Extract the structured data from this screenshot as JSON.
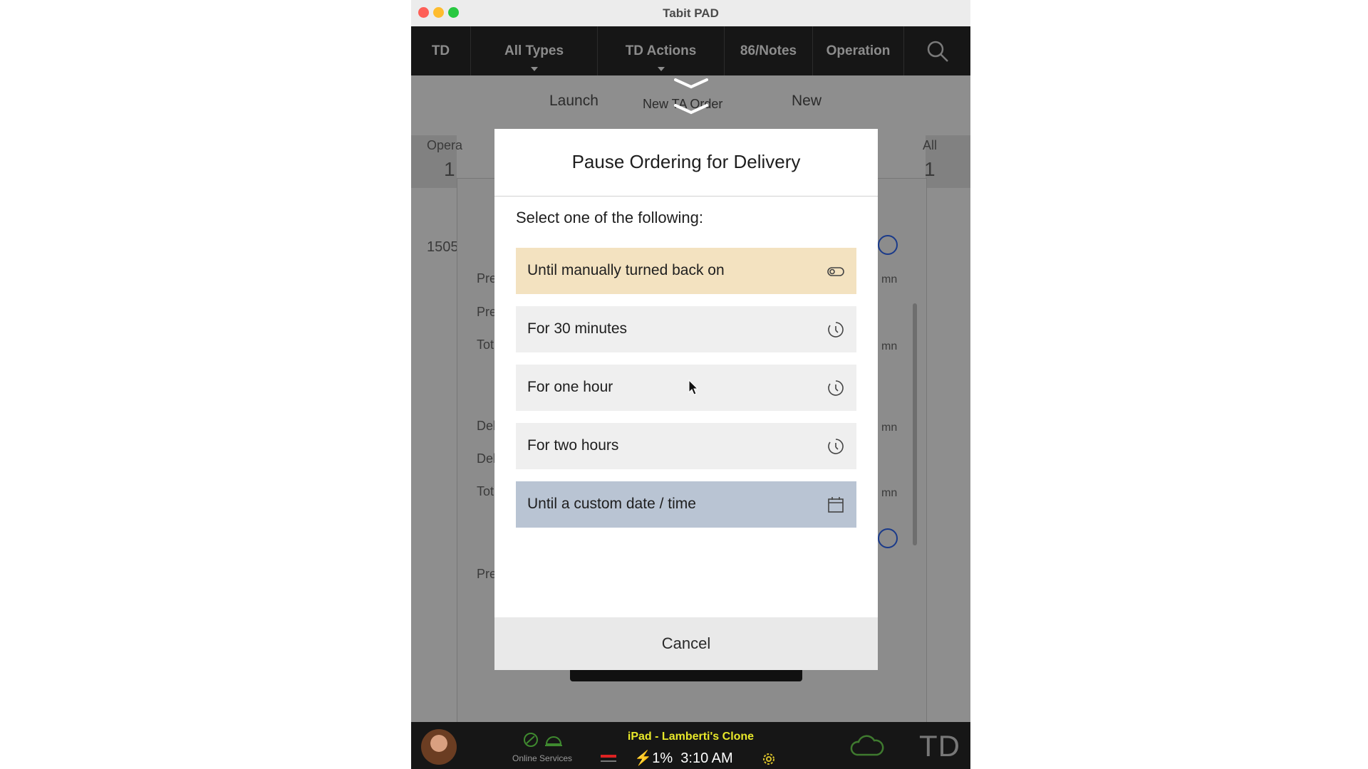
{
  "window": {
    "title": "Tabit PAD"
  },
  "topnav": {
    "items": [
      "TD",
      "All Types",
      "TD Actions",
      "86/Notes",
      "Operation"
    ]
  },
  "background": {
    "tabs": [
      "Launch",
      "New TA Order",
      "New"
    ],
    "left_stat_label": "Opera",
    "left_stat_value": "1",
    "right_stat_label": "All",
    "right_stat_value": "1",
    "order_number": "1505",
    "row_labels": [
      "Pre",
      "Pre",
      "Tot",
      "Del",
      "Del",
      "Tot",
      "Pre"
    ],
    "row_suffixes": [
      "mn",
      "mn",
      "mn",
      "mn"
    ]
  },
  "modal": {
    "title": "Pause Ordering for Delivery",
    "prompt": "Select one of the following:",
    "options": [
      {
        "label": "Until manually turned back on",
        "icon": "toggle-icon",
        "bg": "#f3e2c0"
      },
      {
        "label": "For 30 minutes",
        "icon": "timer-icon",
        "bg": "#efefef"
      },
      {
        "label": "For one hour",
        "icon": "timer-icon",
        "bg": "#efefef"
      },
      {
        "label": "For two hours",
        "icon": "timer-icon",
        "bg": "#efefef"
      },
      {
        "label": "Until a custom date / time",
        "icon": "calendar-icon",
        "bg": "#b9c4d3"
      }
    ],
    "cancel_label": "Cancel"
  },
  "bottombar": {
    "device_name": "iPad - Lamberti's Clone",
    "battery": "⚡1%",
    "time": "3:10 AM",
    "online_services_label": "Online Services",
    "mode_label": "TD"
  },
  "colors": {
    "highlight_option": "#f3e2c0",
    "custom_option": "#b9c4d3",
    "device_name_color": "#e8e82a"
  }
}
